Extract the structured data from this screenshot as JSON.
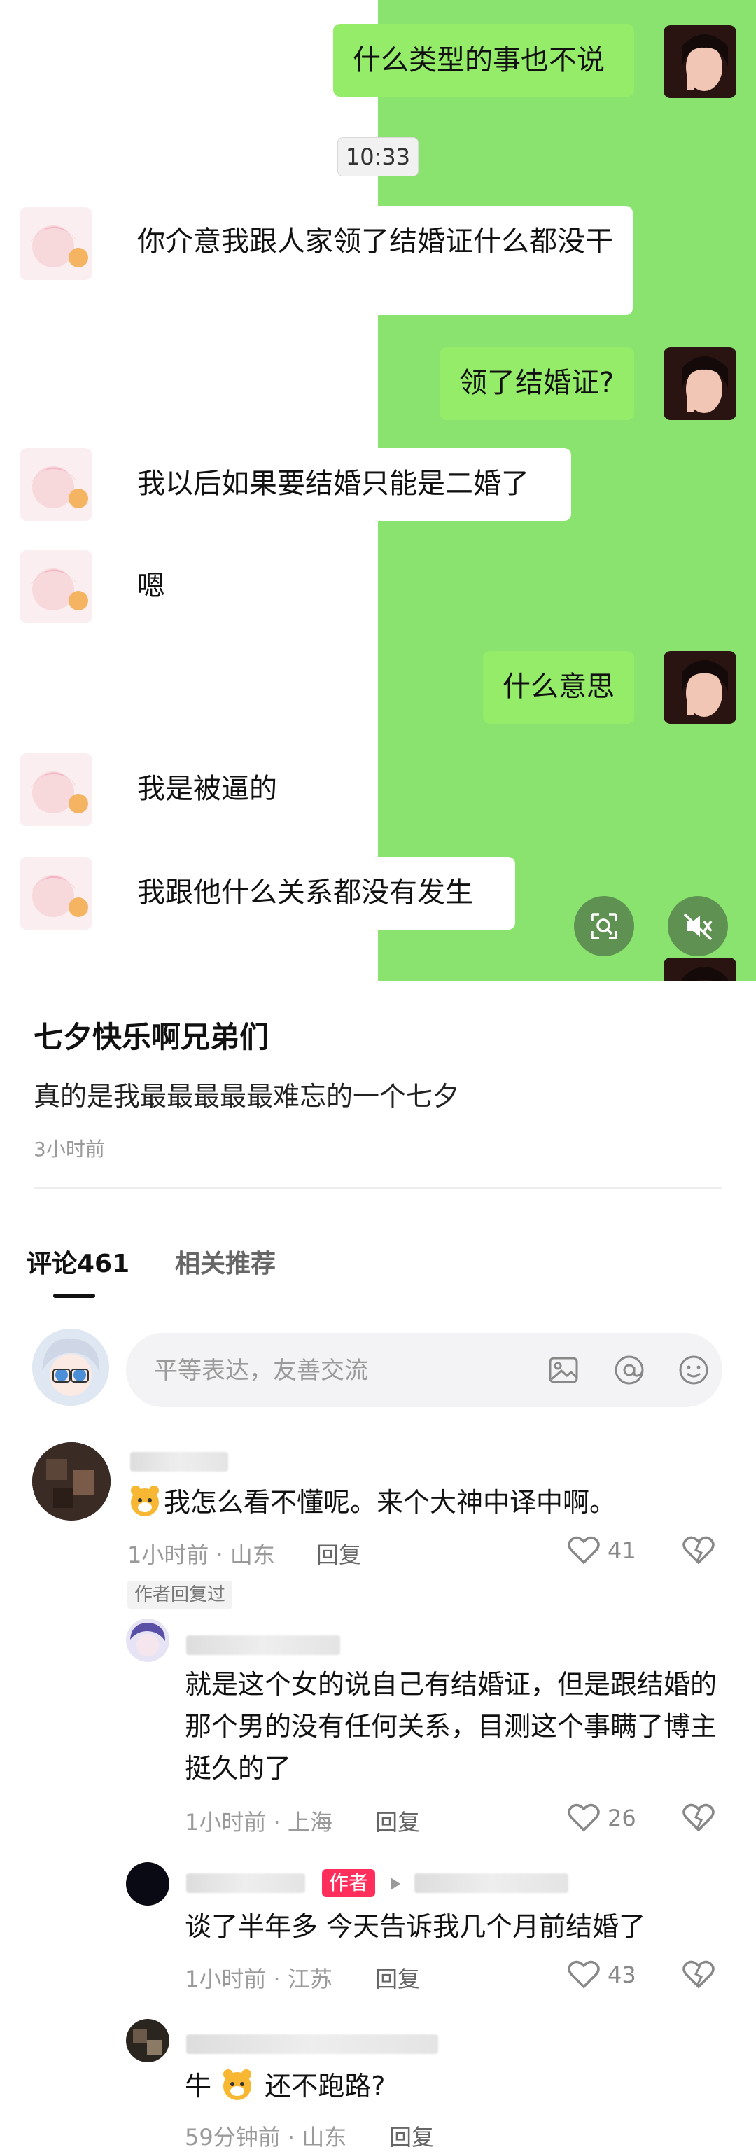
{
  "chat": {
    "timestamp": "10:33",
    "messages": [
      {
        "side": "right",
        "text": "什么类型的事也不说"
      },
      {
        "side": "left",
        "text": "你介意我跟人家领了结婚证什么都没干"
      },
      {
        "side": "right",
        "text": "领了结婚证?"
      },
      {
        "side": "left",
        "text": "我以后如果要结婚只能是二婚了"
      },
      {
        "side": "left",
        "text": "嗯"
      },
      {
        "side": "right",
        "text": "什么意思"
      },
      {
        "side": "left",
        "text": "我是被逼的"
      },
      {
        "side": "left",
        "text": "我跟他什么关系都没有发生"
      }
    ]
  },
  "post": {
    "title": "七夕快乐啊兄弟们",
    "body": "真的是我最最最最最难忘的一个七夕",
    "time": "3小时前"
  },
  "tabs": {
    "comments": "评论461",
    "related": "相关推荐"
  },
  "comment_input": {
    "placeholder": "平等表达，友善交流"
  },
  "comments": [
    {
      "text": "我怎么看不懂呢。来个大神中译中啊。",
      "meta": "1小时前 · 山东",
      "reply": "回复",
      "likes": "41",
      "badge": "作者回复过"
    },
    {
      "text": "就是这个女的说自己有结婚证，但是跟结婚的那个男的没有任何关系，目测这个事瞒了博主挺久的了",
      "meta": "1小时前 · 上海",
      "reply": "回复",
      "likes": "26"
    },
    {
      "tag": "作者",
      "text": "谈了半年多 今天告诉我几个月前结婚了",
      "meta": "1小时前 · 江苏",
      "reply": "回复",
      "likes": "43"
    },
    {
      "text_before": "牛",
      "text_after": "还不跑路?",
      "meta": "59分钟前 · 山东",
      "reply": "回复"
    }
  ],
  "colors": {
    "chat_green": "#95ec69",
    "author_tag": "#ff2e5b"
  }
}
